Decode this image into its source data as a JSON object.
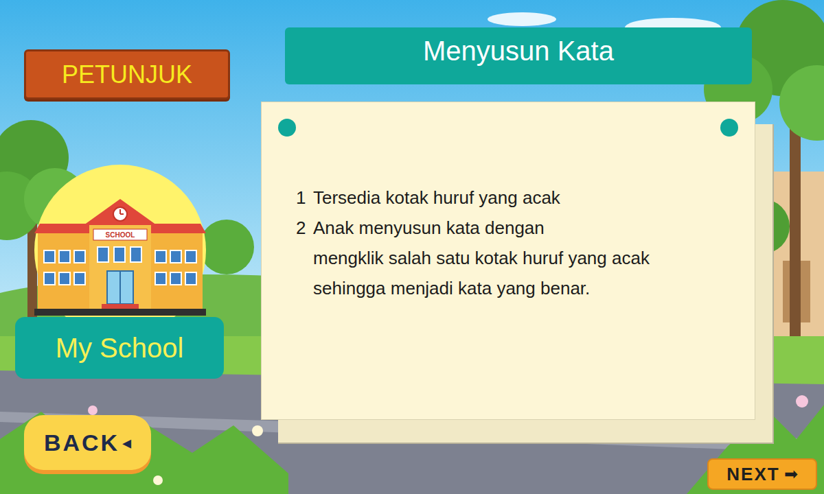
{
  "sign": {
    "label": "PETUNJUK"
  },
  "title": "Menyusun Kata",
  "instructions": [
    {
      "number": "1",
      "lines": [
        "Tersedia kotak huruf yang acak"
      ]
    },
    {
      "number": "2",
      "lines": [
        "Anak menyusun kata dengan",
        "mengklik salah satu kotak huruf yang acak",
        "sehingga menjadi kata yang benar."
      ]
    }
  ],
  "topic": {
    "label": "My School",
    "sign": "SCHOOL"
  },
  "buttons": {
    "back": {
      "label": "BACK",
      "icon": "◂"
    },
    "next": {
      "label": "NEXT",
      "icon": "➡"
    }
  }
}
